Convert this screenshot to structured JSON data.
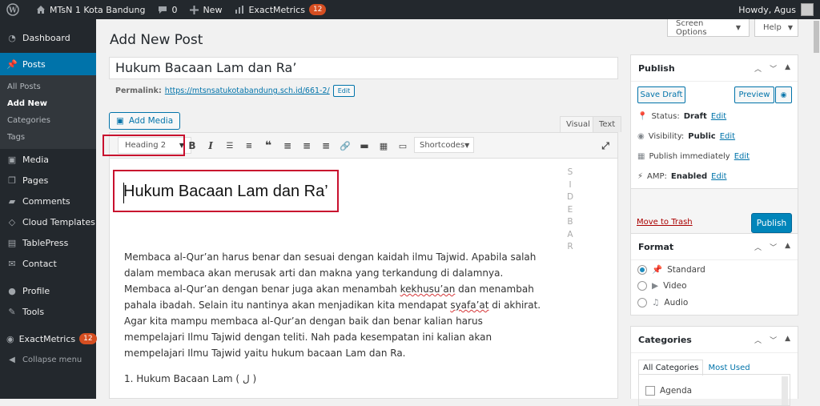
{
  "admin_bar": {
    "site_name": "MTsN 1 Kota Bandung",
    "comments_count": "0",
    "new_label": "New",
    "exact_label": "ExactMetrics",
    "exact_count": "12",
    "howdy": "Howdy, Agus"
  },
  "menu": {
    "dashboard": "Dashboard",
    "posts": "Posts",
    "sub": [
      "All Posts",
      "Add New",
      "Categories",
      "Tags"
    ],
    "media": "Media",
    "pages": "Pages",
    "comments": "Comments",
    "cloud": "Cloud Templates",
    "tablepress": "TablePress",
    "contact": "Contact",
    "profile": "Profile",
    "tools": "Tools",
    "exact": "ExactMetrics",
    "exact_count": "12",
    "collapse": "Collapse menu"
  },
  "top_buttons": {
    "screen_options": "Screen Options",
    "help": "Help"
  },
  "page_title": "Add New Post",
  "post": {
    "title": "Hukum Bacaan Lam dan Ra’",
    "permalink_label": "Permalink:",
    "permalink_url": "https://mtsnsatukotabandung.sch.id/661-2/",
    "edit_label": "Edit"
  },
  "editor": {
    "add_media": "Add Media",
    "tab_visual": "Visual",
    "tab_text": "Text",
    "format_value": "Heading 2",
    "shortcodes": "Shortcodes",
    "heading": "Hukum Bacaan Lam dan Ra’",
    "sidebar_letters": [
      "S",
      "I",
      "D",
      "E",
      "B",
      "A",
      "R"
    ],
    "paragraph": {
      "p1": "Membaca al-Qur’an harus benar dan sesuai dengan kaidah ilmu Tajwid. Apabila salah dalam membaca akan merusak arti dan makna yang terkandung di dalamnya. Membaca al-Qur’an dengan benar juga akan menambah ",
      "w1": "kekhusu’an",
      "p2": " dan menambah pahala ibadah. Selain itu nantinya akan menjadikan kita mendapat ",
      "w2": "syafa’at",
      "p3": " di akhirat. Agar kita mampu membaca al-Qur’an dengan baik dan benar kalian harus mempelajari Ilmu Tajwid dengan teliti. Nah pada kesempatan ini kalian akan mempelajari Ilmu Tajwid yaitu hukum bacaan Lam dan Ra."
    },
    "list_item_1": "1. Hukum Bacaan Lam ( ل )"
  },
  "publish": {
    "title": "Publish",
    "save_draft": "Save Draft",
    "preview": "Preview",
    "status_label": "Status:",
    "status_value": "Draft",
    "visibility_label": "Visibility:",
    "visibility_value": "Public",
    "schedule": "Publish immediately",
    "amp_label": "AMP:",
    "amp_value": "Enabled",
    "edit": "Edit",
    "trash": "Move to Trash",
    "publish_btn": "Publish"
  },
  "format_box": {
    "title": "Format",
    "options": [
      "Standard",
      "Video",
      "Audio"
    ],
    "selected": "Standard"
  },
  "categories_box": {
    "title": "Categories",
    "tab_all": "All Categories",
    "tab_used": "Most Used",
    "items": [
      "Agenda"
    ]
  },
  "colors": {
    "accent": "#0073aa",
    "highlight": "#c8102e",
    "adminbar": "#23282d"
  }
}
